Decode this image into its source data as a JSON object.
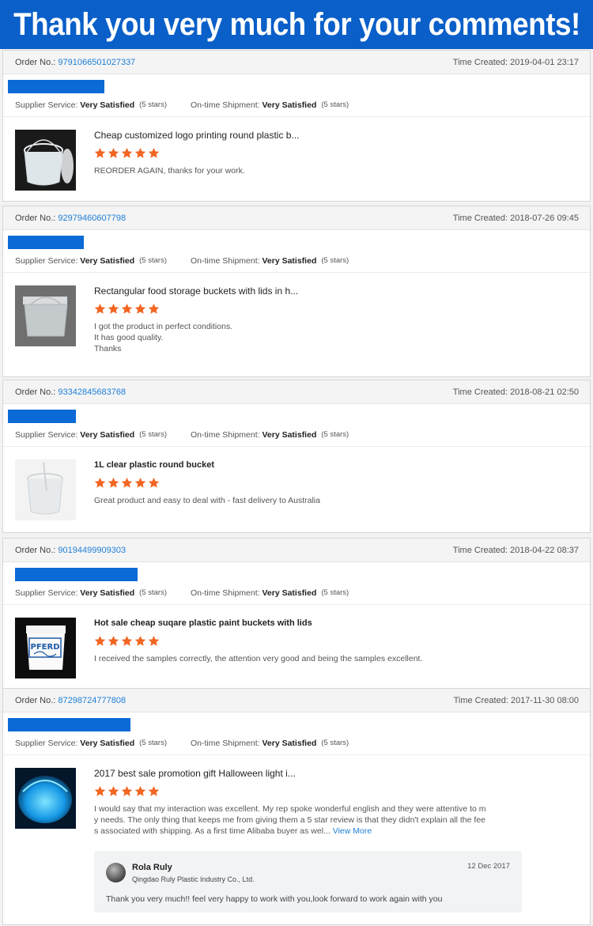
{
  "banner": {
    "title": "Thank you very much for your comments!"
  },
  "labels": {
    "order_no": "Order No.:",
    "time_created": "Time Created:",
    "supplier_service": "Supplier Service:",
    "ontime_shipment": "On-time Shipment:"
  },
  "colors": {
    "accent_blue": "#0a5fc9",
    "star_orange": "#f26522",
    "link_blue": "#1e7fd6"
  },
  "reviews": [
    {
      "order_no": "9791066501027337",
      "time_created": "2019-04-01 23:17",
      "supplier_service": "Very Satisfied",
      "supplier_stars": "(5 stars)",
      "shipment": "Very Satisfied",
      "shipment_stars": "(5 stars)",
      "product_icon": "round-plastic-bucket-icon",
      "product_title": "Cheap customized logo printing round plastic b...",
      "rating": 5,
      "text_lines": [
        "REORDER AGAIN, thanks for your work."
      ]
    },
    {
      "order_no": "92979460607798",
      "time_created": "2018-07-26 09:45",
      "supplier_service": "Very Satisfied",
      "supplier_stars": "(5 stars)",
      "shipment": "Very Satisfied",
      "shipment_stars": "(5 stars)",
      "product_icon": "rectangular-bucket-icon",
      "product_title": "Rectangular food storage buckets with lids in h...",
      "rating": 5,
      "text_lines": [
        "I got the product in perfect conditions.",
        "It has good quality.",
        "Thanks"
      ]
    },
    {
      "order_no": "93342845683768",
      "time_created": "2018-08-21 02:50",
      "supplier_service": "Very Satisfied",
      "supplier_stars": "(5 stars)",
      "shipment": "Very Satisfied",
      "shipment_stars": "(5 stars)",
      "product_icon": "clear-bucket-icon",
      "product_title": "1L clear plastic round bucket",
      "rating": 5,
      "text_lines": [
        "Great product and easy to deal with - fast delivery to Australia"
      ]
    },
    {
      "order_no": "90194499909303",
      "time_created": "2018-04-22 08:37",
      "supplier_service": "Very Satisfied",
      "supplier_stars": "(5 stars)",
      "shipment": "Very Satisfied",
      "shipment_stars": "(5 stars)",
      "product_icon": "square-paint-bucket-icon",
      "product_title": "Hot sale cheap suqare plastic paint buckets with lids",
      "rating": 5,
      "text_lines": [
        "I received the samples correctly, the attention very good and being the samples excellent."
      ],
      "brand_on_product": "PFERD"
    },
    {
      "order_no": "87298724777808",
      "time_created": "2017-11-30 08:00",
      "supplier_service": "Very Satisfied",
      "supplier_stars": "(5 stars)",
      "shipment": "Very Satisfied",
      "shipment_stars": "(5 stars)",
      "product_icon": "glowing-light-bucket-icon",
      "product_title": "2017 best sale promotion gift Halloween light i...",
      "rating": 5,
      "text_lines": [
        "I would say that my interaction was excellent. My rep spoke wonderful english and they were attentive to m",
        "y needs. The only thing that keeps me from giving them a 5 star review is that they didn't explain all the fee",
        "s associated with shipping. As a first time Alibaba buyer as wel..."
      ],
      "view_more": "View More",
      "reply": {
        "name": "Rola Ruly",
        "company": "Qingdao Ruly Plastic Industry Co., Ltd.",
        "date": "12 Dec 2017",
        "text": "Thank you very much!! feel very happy to work with you,look forward to work again with you"
      }
    }
  ]
}
